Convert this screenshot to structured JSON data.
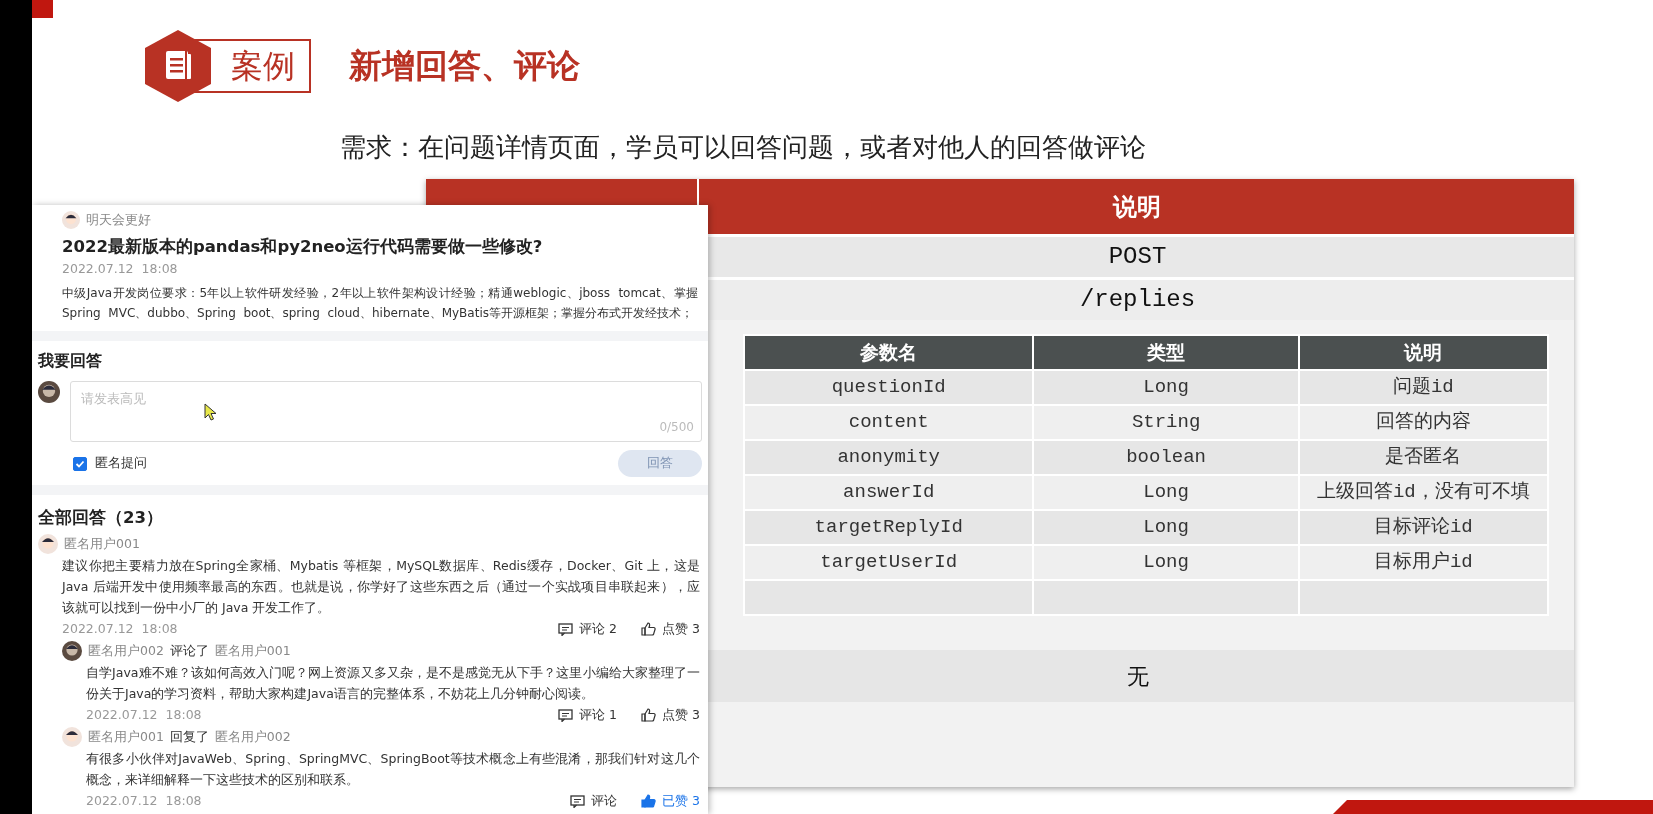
{
  "header": {
    "badge": "案例",
    "title": "新增回答、评论"
  },
  "requirement": "需求：在问题详情页面，学员可以回答问题，或者对他人的回答做评论",
  "api_table": {
    "header_label": "说明",
    "method": "POST",
    "path": "/replies",
    "params": {
      "columns": [
        "参数名",
        "类型",
        "说明"
      ],
      "rows": [
        [
          "questionId",
          "Long",
          "问题id"
        ],
        [
          "content",
          "String",
          "回答的内容"
        ],
        [
          "anonymity",
          "boolean",
          "是否匿名"
        ],
        [
          "answerId",
          "Long",
          "上级回答id，没有可不填"
        ],
        [
          "targetReplyId",
          "Long",
          "目标评论id"
        ],
        [
          "targetUserId",
          "Long",
          "目标用户id"
        ]
      ]
    },
    "returns": "无"
  },
  "screenshot": {
    "question": {
      "author": "明天会更好",
      "title": "2022最新版本的pandas和py2neo运行代码需要做一些修改?",
      "date": "2022.07.12  18:08",
      "body": "中级Java开发岗位要求：5年以上软件研发经验，2年以上软件架构设计经验；精通weblogic、jboss  tomcat、掌握Spring  MVC、dubbo、Spring  boot、spring  cloud、hibernate、MyBatis等开源框架；掌握分布式开发经技术；"
    },
    "answer_form": {
      "heading": "我要回答",
      "placeholder": "请发表高见",
      "counter": "0/500",
      "anonymous": {
        "label": "匿名提问",
        "checked": true
      },
      "submit": {
        "label": "回答",
        "disabled": true
      }
    },
    "answers_heading": "全部回答（23）",
    "answers": [
      {
        "author": "匿名用户001",
        "content": "建议你把主要精力放在Spring全家桶、Mybatis 等框架，MySQL数据库、Redis缓存，Docker、Git 上，这是 Java 后端开发中使用频率最高的东西。也就是说，你学好了这些东西之后（通过一个实战项目串联起来），应该就可以找到一份中小厂的 Java 开发工作了。",
        "date": "2022.07.12  18:08",
        "comment_label": "评论 2",
        "like_label": "点赞 3",
        "liked": false,
        "replies": [
          {
            "author": "匿名用户002",
            "action": "评论了",
            "target": "匿名用户001",
            "content": "自学Java难不难？该如何高效入门呢？网上资源又多又杂，是不是感觉无从下手？这里小编给大家整理了一份关于Java的学习资料，帮助大家构建Java语言的完整体系，不妨花上几分钟耐心阅读。",
            "date": "2022.07.12  18:08",
            "comment_label": "评论 1",
            "like_label": "点赞 3",
            "liked": false
          },
          {
            "author": "匿名用户001",
            "action": "回复了",
            "target": "匿名用户002",
            "content": "有很多小伙伴对JavaWeb、Spring、SpringMVC、SpringBoot等技术概念上有些混淆，那我们针对这几个概念，来详细解释一下这些技术的区别和联系。",
            "date": "2022.07.12  18:08",
            "comment_label": "评论",
            "like_label": "已赞 3",
            "liked": true
          }
        ]
      }
    ]
  }
}
